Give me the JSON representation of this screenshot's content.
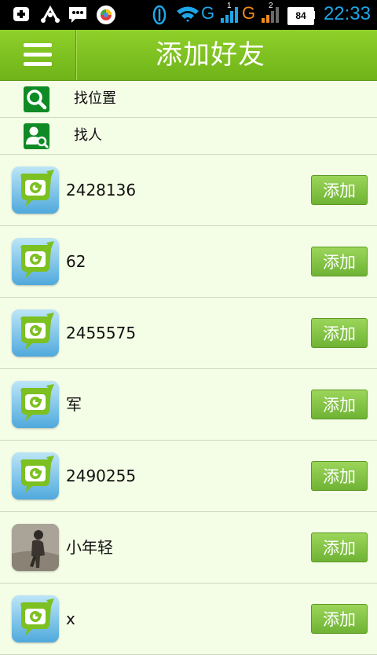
{
  "status_bar": {
    "time": "22:33",
    "battery": "84",
    "network_1": "G",
    "network_2": "G",
    "sim_1": "1",
    "sim_2": "2"
  },
  "header": {
    "title": "添加好友"
  },
  "search_options": [
    {
      "label": "找位置",
      "icon": "search-icon"
    },
    {
      "label": "找人",
      "icon": "find-person-icon"
    }
  ],
  "contacts": [
    {
      "name": "2428136",
      "avatar": "app-logo-avatar",
      "action": "添加"
    },
    {
      "name": "62",
      "avatar": "app-logo-avatar",
      "action": "添加"
    },
    {
      "name": "2455575",
      "avatar": "app-logo-avatar",
      "action": "添加"
    },
    {
      "name": "军",
      "avatar": "app-logo-avatar",
      "action": "添加"
    },
    {
      "name": "2490255",
      "avatar": "app-logo-avatar",
      "action": "添加"
    },
    {
      "name": "小年轻",
      "avatar": "photo-avatar",
      "action": "添加"
    },
    {
      "name": "x",
      "avatar": "app-logo-avatar",
      "action": "添加"
    }
  ],
  "colors": {
    "accent": "#7cc021",
    "background": "#f4fde6",
    "time_color": "#1ea7e8",
    "icon_green": "#0f8a24"
  }
}
